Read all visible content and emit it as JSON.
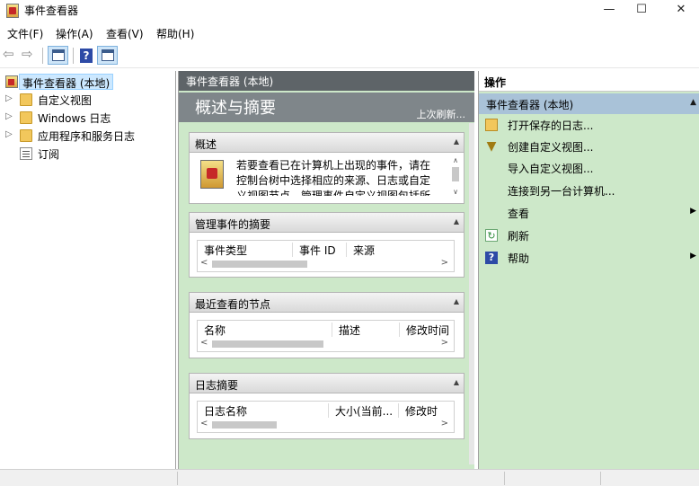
{
  "window": {
    "title": "事件查看器",
    "minimize_glyph": "—",
    "maximize_glyph": "☐",
    "close_glyph": "✕"
  },
  "menu": [
    "文件(F)",
    "操作(A)",
    "查看(V)",
    "帮助(H)"
  ],
  "toolbar": {
    "back_glyph": "⇦",
    "forward_glyph": "⇨",
    "help_glyph": "?"
  },
  "tree": {
    "expand_glyph": "▷",
    "items": [
      {
        "label": "事件查看器 (本地)",
        "selected": true
      },
      {
        "label": "自定义视图"
      },
      {
        "label": "Windows 日志"
      },
      {
        "label": "应用程序和服务日志"
      },
      {
        "label": "订阅"
      }
    ]
  },
  "center": {
    "header": "事件查看器 (本地)",
    "title": "概述与摘要",
    "refresh_link": "上次刷新...",
    "collapse_glyph": "▲",
    "scroll_up_glyph": "∧",
    "scroll_down_glyph": "∨",
    "scroll_left_glyph": "<",
    "scroll_right_glyph": ">",
    "sections": {
      "overview": {
        "title": "概述",
        "text": "若要查看已在计算机上出现的事件，请在控制台树中选择相应的来源、日志或自定义视图节点。管理事件自定义视图包括所"
      },
      "admin_summary": {
        "title": "管理事件的摘要",
        "columns": [
          "事件类型",
          "事件 ID",
          "来源"
        ]
      },
      "recent_nodes": {
        "title": "最近查看的节点",
        "columns": [
          "名称",
          "描述",
          "修改时间"
        ]
      },
      "log_summary": {
        "title": "日志摘要",
        "columns": [
          "日志名称",
          "大小(当前...",
          "修改时"
        ]
      }
    }
  },
  "actions": {
    "header": "操作",
    "group": "事件查看器 (本地)",
    "group_collapse_glyph": "▲",
    "submenu_glyph": "▶",
    "items": [
      {
        "label": "打开保存的日志...",
        "icon": "folder-open-icon",
        "glyph": ""
      },
      {
        "label": "创建自定义视图...",
        "icon": "filter-icon",
        "glyph": "▼"
      },
      {
        "label": "导入自定义视图...",
        "icon": "",
        "glyph": ""
      },
      {
        "label": "连接到另一台计算机...",
        "icon": "",
        "glyph": ""
      },
      {
        "label": "查看",
        "icon": "",
        "glyph": "",
        "submenu": true
      },
      {
        "label": "刷新",
        "icon": "refresh-icon",
        "glyph": "↻"
      },
      {
        "label": "帮助",
        "icon": "help-icon",
        "glyph": "?",
        "submenu": true
      }
    ]
  },
  "colors": {
    "pane_bg": "#cde8c9",
    "center_header": "#5e6468",
    "center_band": "#7f868a",
    "action_group": "#a9c2d8",
    "selection": "#cce8ff"
  }
}
